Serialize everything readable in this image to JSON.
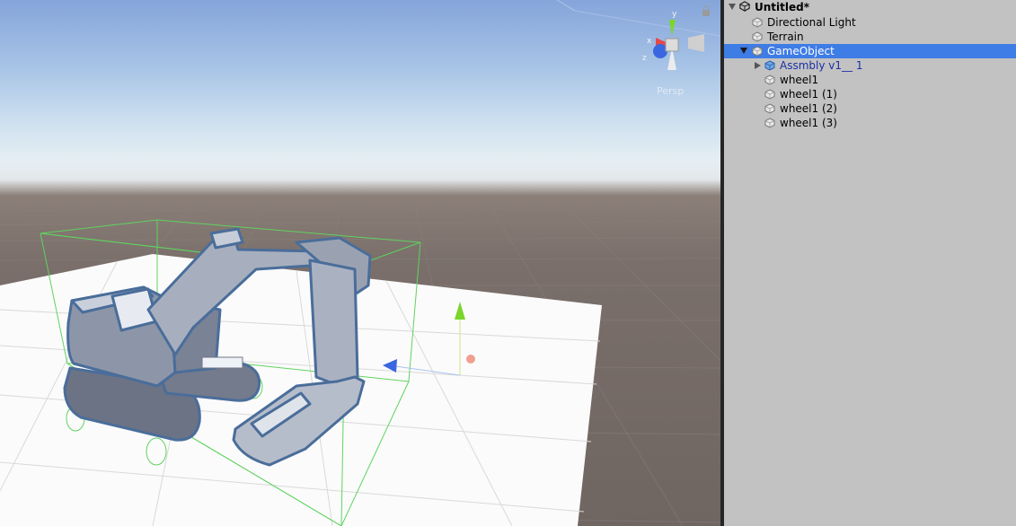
{
  "hierarchy": {
    "scene_name": "Untitled*",
    "items": [
      {
        "label": "Directional Light",
        "icon": "gameobject-icon"
      },
      {
        "label": "Terrain",
        "icon": "gameobject-icon"
      },
      {
        "label": "GameObject",
        "icon": "gameobject-icon",
        "selected": true,
        "expanded": true
      },
      {
        "label": "Assmbly v1__ 1",
        "icon": "prefab-icon",
        "prefab": true,
        "collapsed": true
      },
      {
        "label": "wheel1",
        "icon": "gameobject-icon"
      },
      {
        "label": "wheel1 (1)",
        "icon": "gameobject-icon"
      },
      {
        "label": "wheel1 (2)",
        "icon": "gameobject-icon"
      },
      {
        "label": "wheel1 (3)",
        "icon": "gameobject-icon"
      }
    ]
  },
  "scene_view": {
    "gizmo_axes": {
      "y": "y",
      "x": "x",
      "z": "z"
    },
    "projection_label": "Persp"
  },
  "colors": {
    "selection": "#3e7ce6",
    "panel_bg": "#c2c2c2",
    "prefab_text": "#1b2fa6",
    "bounds_green": "#5fd35f",
    "axis_x": "#e64848",
    "axis_y": "#7ad62a",
    "axis_z": "#3a66e0"
  }
}
